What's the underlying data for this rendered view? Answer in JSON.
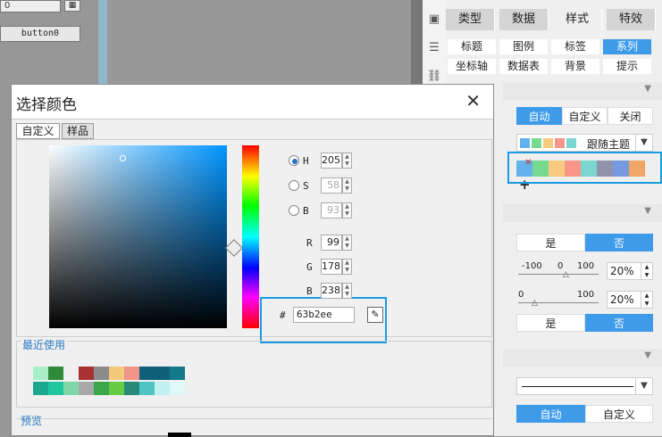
{
  "canvas": {
    "input_value": "0",
    "button_label": "button0"
  },
  "panel": {
    "tabs": [
      {
        "label": "类型",
        "active": false
      },
      {
        "label": "数据",
        "active": false
      },
      {
        "label": "样式",
        "active": true
      },
      {
        "label": "特效",
        "active": false
      }
    ],
    "subtabs_row1": [
      {
        "label": "标题",
        "active": false
      },
      {
        "label": "图例",
        "active": false
      },
      {
        "label": "标签",
        "active": false
      },
      {
        "label": "系列",
        "active": true
      }
    ],
    "subtabs_row2": [
      {
        "label": "坐标轴",
        "active": false
      },
      {
        "label": "数据表",
        "active": false
      },
      {
        "label": "背景",
        "active": false
      },
      {
        "label": "提示",
        "active": false
      }
    ],
    "color_mode": [
      {
        "label": "自动",
        "on": true
      },
      {
        "label": "自定义",
        "on": false
      },
      {
        "label": "关闭",
        "on": false
      }
    ],
    "theme_dropdown": {
      "label": "跟随主题",
      "preview_colors": [
        "#63b2ee",
        "#76da91",
        "#f8cb7f",
        "#f89588",
        "#7cd6cf"
      ]
    },
    "series_colors": [
      "#63b2ee",
      "#76da91",
      "#f8cb7f",
      "#f89588",
      "#7cd6cf",
      "#9192ab",
      "#7898e1",
      "#efa666"
    ],
    "yes_no_1": [
      {
        "label": "是",
        "on": false
      },
      {
        "label": "否",
        "on": true
      }
    ],
    "slider1": {
      "min": "-100",
      "mid": "0",
      "max": "100",
      "value": "20%"
    },
    "slider2": {
      "min": "0",
      "max": "100",
      "value": "20%"
    },
    "yes_no_2": [
      {
        "label": "是",
        "on": false
      },
      {
        "label": "否",
        "on": true
      }
    ],
    "auto_custom": [
      {
        "label": "自动",
        "on": true
      },
      {
        "label": "自定义",
        "on": false
      }
    ]
  },
  "dialog": {
    "title": "选择颜色",
    "tabs": [
      {
        "label": "自定义",
        "active": true
      },
      {
        "label": "样品",
        "active": false
      }
    ],
    "fields": [
      {
        "label": "H",
        "value": "205",
        "radio": true,
        "checked": true,
        "disabled": false
      },
      {
        "label": "S",
        "value": "58",
        "radio": true,
        "checked": false,
        "disabled": true
      },
      {
        "label": "B",
        "value": "93",
        "radio": true,
        "checked": false,
        "disabled": true
      },
      {
        "label": "R",
        "value": "99",
        "radio": false,
        "checked": false,
        "disabled": false
      },
      {
        "label": "G",
        "value": "178",
        "radio": false,
        "checked": false,
        "disabled": false
      },
      {
        "label": "B",
        "value": "238",
        "radio": false,
        "checked": false,
        "disabled": false
      }
    ],
    "hex_prefix": "#",
    "hex_value": "63b2ee",
    "recent_label": "最近使用",
    "recent_colors_row1": [
      "#a8efc8",
      "#2e8b3a",
      "#f0f0f0",
      "#a83232",
      "#8c8c8c",
      "#f5c97a",
      "#f3948a",
      "#10607a",
      "#10607a",
      "#147a8a"
    ],
    "recent_colors_row2": [
      "#1aa88e",
      "#1fc7a0",
      "#7fd8a8",
      "#a8a8a8",
      "#3aa84a",
      "#66cc44",
      "#2a8a7a",
      "#4fc4c4",
      "#c0f0f0",
      "#e0f8f8"
    ],
    "preview_label": "预览"
  }
}
